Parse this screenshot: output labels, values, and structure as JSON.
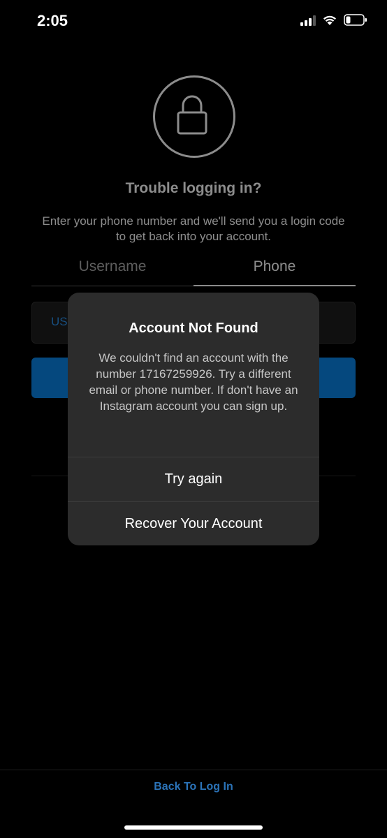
{
  "status_bar": {
    "time": "2:05"
  },
  "screen": {
    "title": "Trouble logging in?",
    "description": "Enter your phone number and we'll send you a login code to get back into your account.",
    "tabs": [
      {
        "label": "Username",
        "active": false
      },
      {
        "label": "Phone",
        "active": true
      }
    ],
    "country_code": "US",
    "accent_color": "#0a84e6"
  },
  "alert": {
    "title": "Account Not Found",
    "message": "We couldn't find an account with the number 17167259926. Try a different email or phone number. If don't have an Instagram account you can sign up.",
    "try_again_label": "Try again",
    "recover_label": "Recover Your Account"
  },
  "footer": {
    "back_to_login": "Back To Log In"
  }
}
